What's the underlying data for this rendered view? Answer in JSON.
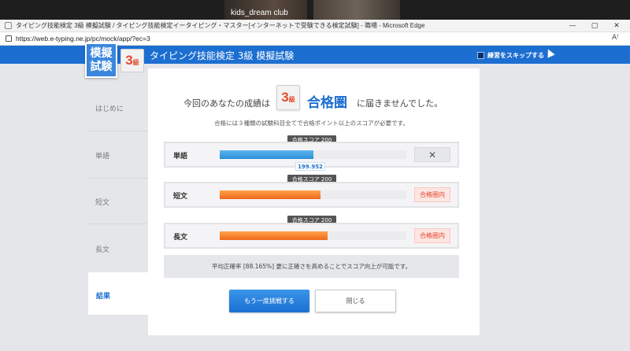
{
  "video": {
    "participant_label": "kids_dream club"
  },
  "window": {
    "title": "タイピング技能検定 3級 模擬試験 / タイピング技能検定イータイピング・マスター[インターネットで受験できる検定試験] - 職場 - Microsoft Edge",
    "minimize": "—",
    "maximize": "▢",
    "close": "✕"
  },
  "browser": {
    "url": "https://web.e-typing.ne.jp/pc/mock/app/?ec=3",
    "read_aloud": "A⁾"
  },
  "header": {
    "logo_line1": "模擬",
    "logo_line2": "試験",
    "grade_num": "3",
    "grade_kyu": "級",
    "title": "タイピング技能検定 3級 模擬試験",
    "skip_label": "練習をスキップする"
  },
  "sidebar": {
    "items": [
      {
        "label": "はじめに"
      },
      {
        "label": "単語"
      },
      {
        "label": "短文"
      },
      {
        "label": "長文"
      },
      {
        "label": "結果"
      }
    ]
  },
  "result": {
    "message_pre": "今回のあなたの成績は",
    "badge_num": "3",
    "badge_kyu": "級",
    "message_strong": "合格圏",
    "message_post": "に届きませんでした。",
    "sub_message": "合格には３種類の試験科目全てで合格ポイント以上のスコアが必要です。"
  },
  "rows": [
    {
      "label": "単語",
      "pass_tip": "合格スコア 200",
      "fill_ratio": 0.5,
      "color": "blue",
      "status": "✕",
      "score": "199.952"
    },
    {
      "label": "短文",
      "pass_tip": "合格スコア 200",
      "fill_ratio": 0.54,
      "color": "orange",
      "status": "合格圏内"
    },
    {
      "label": "長文",
      "pass_tip": "合格スコア 200",
      "fill_ratio": 0.58,
      "color": "orange",
      "status": "合格圏内"
    }
  ],
  "accuracy_text": "平均正確率 [88.165%] 更に正確さを高めることでスコア向上が可能です。",
  "buttons": {
    "retry": "もう一度挑戦する",
    "close": "閉じる"
  },
  "colors": {
    "brand_blue": "#1c6fd1",
    "pass_red": "#e2452a",
    "bar_orange": "#f06a1b",
    "bar_blue": "#2b8fd8"
  }
}
